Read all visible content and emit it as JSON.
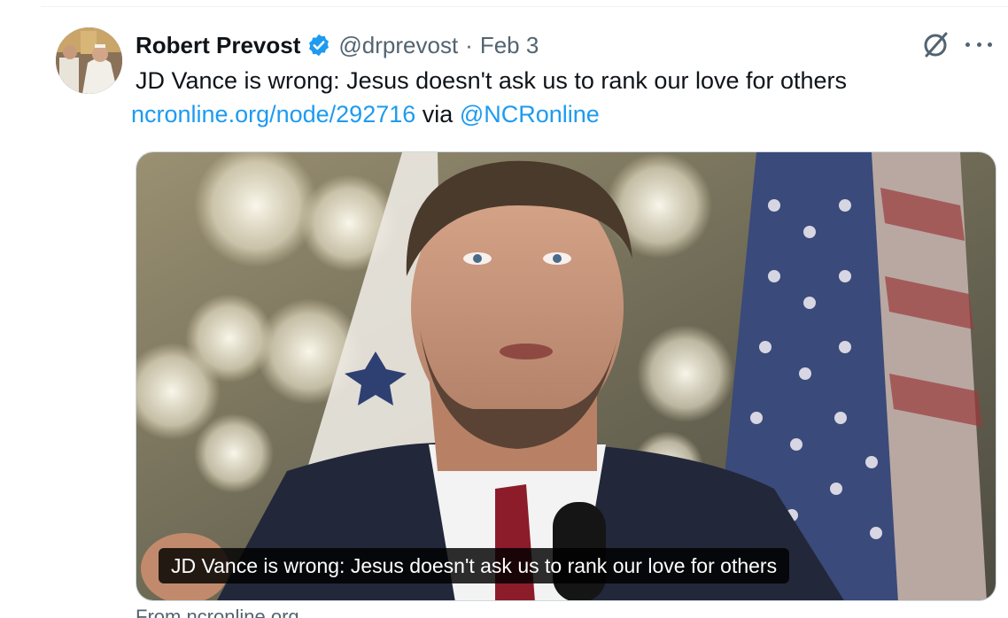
{
  "tweet": {
    "author": {
      "display_name": "Robert Prevost",
      "handle": "@drprevost",
      "verified": true
    },
    "separator": "·",
    "timestamp": "Feb 3",
    "text": "JD Vance is wrong: Jesus doesn't ask us to rank our love for others",
    "link_text": "ncronline.org/node/292716",
    "via_text": "via",
    "mention": "@NCRonline",
    "card": {
      "caption": "JD Vance is wrong: Jesus doesn't ask us to rank our love for others",
      "source": "From ncronline.org"
    },
    "icons": {
      "verified": "verified-badge-icon",
      "grok": "grok-icon",
      "more": "more-options-icon"
    }
  },
  "colors": {
    "link": "#1d9bf0",
    "secondary_text": "#536471",
    "primary_text": "#0f1419",
    "border": "#cfd9de"
  }
}
